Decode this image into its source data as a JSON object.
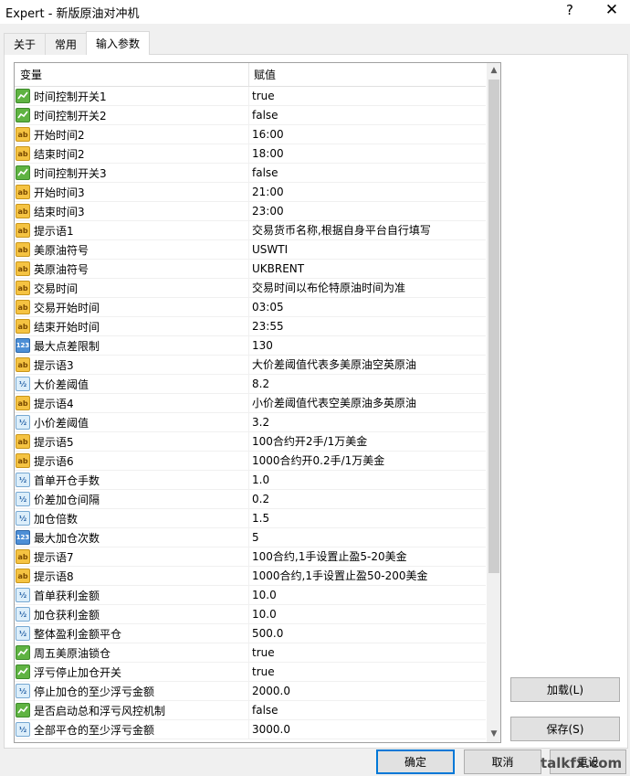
{
  "window": {
    "title": "Expert - 新版原油对冲机",
    "help_label": "?",
    "close_label": "✕"
  },
  "tabs": [
    {
      "label": "关于",
      "active": false
    },
    {
      "label": "常用",
      "active": false
    },
    {
      "label": "输入参数",
      "active": true
    }
  ],
  "grid": {
    "col_variable": "变量",
    "col_value": "赋值",
    "rows": [
      {
        "icon": "bool",
        "name": "时间控制开关1",
        "value": "true"
      },
      {
        "icon": "bool",
        "name": "时间控制开关2",
        "value": "false"
      },
      {
        "icon": "str",
        "name": "开始时间2",
        "value": "16:00"
      },
      {
        "icon": "str",
        "name": "结束时间2",
        "value": "18:00"
      },
      {
        "icon": "bool",
        "name": "时间控制开关3",
        "value": "false"
      },
      {
        "icon": "str",
        "name": "开始时间3",
        "value": "21:00"
      },
      {
        "icon": "str",
        "name": "结束时间3",
        "value": "23:00"
      },
      {
        "icon": "str",
        "name": "提示语1",
        "value": "交易货币名称,根据自身平台自行填写"
      },
      {
        "icon": "str",
        "name": "美原油符号",
        "value": "USWTI"
      },
      {
        "icon": "str",
        "name": "英原油符号",
        "value": "UKBRENT"
      },
      {
        "icon": "str",
        "name": "交易时间",
        "value": "交易时间以布伦特原油时间为准"
      },
      {
        "icon": "str",
        "name": "交易开始时间",
        "value": "03:05"
      },
      {
        "icon": "str",
        "name": "结束开始时间",
        "value": "23:55"
      },
      {
        "icon": "int",
        "name": "最大点差限制",
        "value": "130"
      },
      {
        "icon": "str",
        "name": "提示语3",
        "value": "大价差阈值代表多美原油空英原油"
      },
      {
        "icon": "dbl",
        "name": "大价差阈值",
        "value": "8.2"
      },
      {
        "icon": "str",
        "name": "提示语4",
        "value": "小价差阈值代表空美原油多英原油"
      },
      {
        "icon": "dbl",
        "name": "小价差阈值",
        "value": "3.2"
      },
      {
        "icon": "str",
        "name": "提示语5",
        "value": "100合约开2手/1万美金"
      },
      {
        "icon": "str",
        "name": "提示语6",
        "value": "1000合约开0.2手/1万美金"
      },
      {
        "icon": "dbl",
        "name": "首单开仓手数",
        "value": "1.0"
      },
      {
        "icon": "dbl",
        "name": "价差加仓间隔",
        "value": "0.2"
      },
      {
        "icon": "dbl",
        "name": "加仓倍数",
        "value": "1.5"
      },
      {
        "icon": "int",
        "name": "最大加仓次数",
        "value": "5"
      },
      {
        "icon": "str",
        "name": "提示语7",
        "value": "100合约,1手设置止盈5-20美金"
      },
      {
        "icon": "str",
        "name": "提示语8",
        "value": "1000合约,1手设置止盈50-200美金"
      },
      {
        "icon": "dbl",
        "name": "首单获利金额",
        "value": "10.0"
      },
      {
        "icon": "dbl",
        "name": "加仓获利金额",
        "value": "10.0"
      },
      {
        "icon": "dbl",
        "name": "整体盈利金额平仓",
        "value": "500.0"
      },
      {
        "icon": "bool",
        "name": "周五美原油锁仓",
        "value": "true"
      },
      {
        "icon": "bool",
        "name": "浮亏停止加仓开关",
        "value": "true"
      },
      {
        "icon": "dbl",
        "name": "停止加仓的至少浮亏金额",
        "value": "2000.0"
      },
      {
        "icon": "bool",
        "name": "是否启动总和浮亏风控机制",
        "value": "false"
      },
      {
        "icon": "dbl",
        "name": "全部平仓的至少浮亏金额",
        "value": "3000.0"
      }
    ]
  },
  "icon_names": {
    "bool": "boolean-icon",
    "str": "string-icon",
    "int": "integer-icon",
    "dbl": "double-icon"
  },
  "icon_glyphs": {
    "bool": "",
    "str": "ab",
    "int": "123",
    "dbl": "½"
  },
  "buttons": {
    "load": "加载(L)",
    "save": "保存(S)",
    "ok": "确定",
    "cancel": "取消",
    "reset": "重设"
  },
  "watermark": "talkfx.com"
}
